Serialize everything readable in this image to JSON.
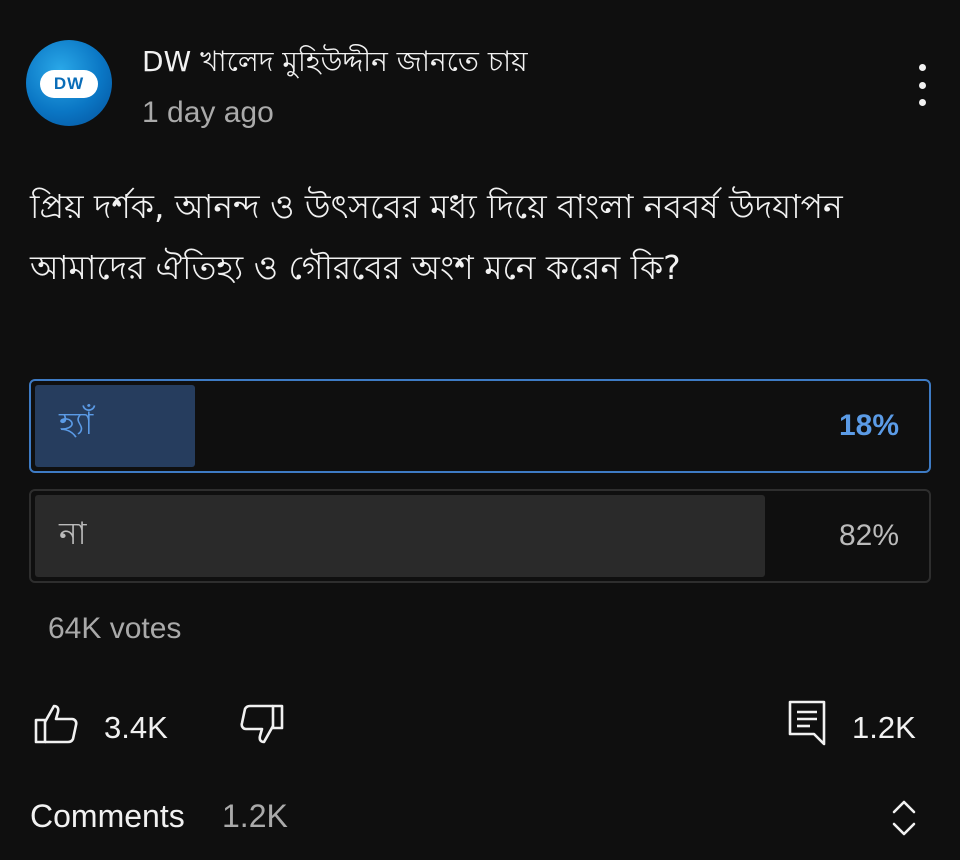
{
  "post": {
    "avatar": {
      "logo_text": "DW",
      "color": "#0a76c4"
    },
    "channel_name": "DW খালেদ মুহিউদ্দীন জানতে চায়",
    "timestamp": "1 day ago",
    "more_icon": "more-vertical-icon",
    "question": "প্রিয় দর্শক, আনন্দ ও উৎসবের মধ্য দিয়ে বাংলা নববর্ষ উদযাপন আমাদের ঐতিহ্য ও গৌরবের অংশ মনে করেন কি?"
  },
  "poll": {
    "options": [
      {
        "label": "হ্যাঁ",
        "percent_text": "18%",
        "percent": 18,
        "selected": true
      },
      {
        "label": "না",
        "percent_text": "82%",
        "percent": 82,
        "selected": false
      }
    ],
    "votes": "64K votes",
    "accent": "#3e7bc4"
  },
  "actions": {
    "like_icon": "thumbs-up-icon",
    "like_count": "3.4K",
    "dislike_icon": "thumbs-down-icon",
    "comment_icon": "comment-icon",
    "comment_count": "1.2K"
  },
  "comments": {
    "title": "Comments",
    "count": "1.2K",
    "expand_icon": "expand-collapse-icon"
  }
}
